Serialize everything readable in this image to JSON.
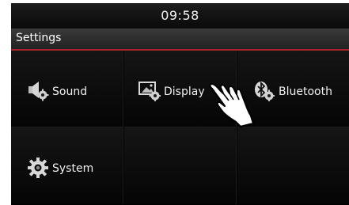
{
  "status": {
    "time": "09:58"
  },
  "header": {
    "title": "Settings"
  },
  "menu": {
    "items": [
      {
        "label": "Sound",
        "icon": "speaker-gear-icon"
      },
      {
        "label": "Display",
        "icon": "picture-gear-icon"
      },
      {
        "label": "Bluetooth",
        "icon": "bluetooth-gear-icon"
      },
      {
        "label": "System",
        "icon": "gear-icon"
      }
    ]
  },
  "colors": {
    "accent": "#a3232b",
    "background": "#000000",
    "text": "#f0f0f0"
  }
}
